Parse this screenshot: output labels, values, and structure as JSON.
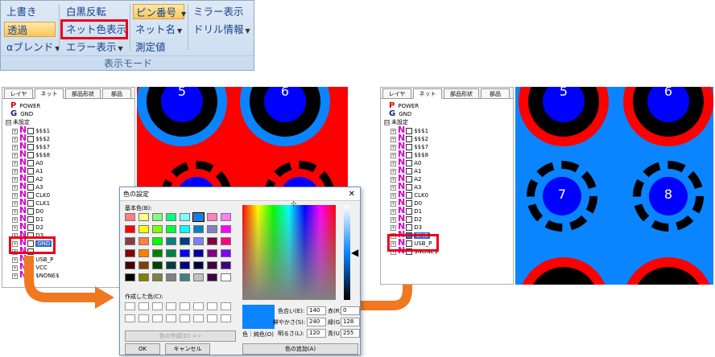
{
  "ribbon": {
    "overwrite": "上書き",
    "transparent": "透過",
    "alpha_blend": "αブレンド",
    "invert": "白黒反転",
    "net_color": "ネット色表示",
    "error_display": "エラー表示",
    "pin_number": "ピン番号",
    "net_name": "ネット名",
    "measured_value": "測定値",
    "mirror": "ミラー表示",
    "drill_info": "ドリル情報",
    "group_label": "表示モード"
  },
  "left_panel": {
    "tabs": [
      "レイヤ",
      "ネット",
      "部品形状",
      "部品"
    ],
    "top_rows": [
      {
        "icon": "P",
        "label": "POWER"
      },
      {
        "icon": "G",
        "label": "GND"
      },
      {
        "icon": "",
        "label": "未設定"
      }
    ],
    "nets": [
      "$$$1",
      "$$$2",
      "$$$7",
      "$$$8",
      "A0",
      "A1",
      "A2",
      "A3",
      "CLK0",
      "CLK1",
      "D0",
      "D1",
      "D2",
      "D3",
      "GND",
      "",
      "USB_P",
      "VCC",
      "$NONE$"
    ]
  },
  "right_panel": {
    "tabs": [
      "レイヤ",
      "ネット",
      "部品形状",
      "部品"
    ],
    "top_rows": [
      {
        "icon": "P",
        "label": "POWER"
      },
      {
        "icon": "G",
        "label": "GND"
      },
      {
        "icon": "",
        "label": "未設定"
      }
    ],
    "nets": [
      "$$$1",
      "$$$2",
      "$$$7",
      "$$$8",
      "A0",
      "A1",
      "A2",
      "A3",
      "CLK0",
      "D0",
      "D1",
      "D2",
      "D3",
      "GND",
      "USB_P",
      "$NONE$"
    ]
  },
  "board_left": {
    "pins": [
      "5",
      "6"
    ],
    "bg_color": "#ff0000"
  },
  "board_right": {
    "pins": [
      "5",
      "6",
      "7",
      "8"
    ],
    "bg_color": "#0a84ff"
  },
  "color_dialog": {
    "title": "色の設定",
    "basic_colors_label": "基本色(B):",
    "custom_colors_label": "作成した色(C):",
    "define_button": "色の作成(D) >>",
    "ok": "OK",
    "cancel": "キャンセル",
    "color_solid_label": "色｜純色(O)",
    "hue_label": "色合い(E):",
    "hue": "140",
    "sat_label": "鮮やかさ(S):",
    "sat": "240",
    "lum_label": "明るさ(L):",
    "lum": "120",
    "red_label": "赤(R):",
    "red": "0",
    "green_label": "緑(G):",
    "green": "128",
    "blue_label": "青(U):",
    "blue": "255",
    "add_button": "色の追加(A)",
    "selected_color": "#0a84ff"
  },
  "colors": {
    "highlight": "#e8001c",
    "arrow": "#f07820",
    "net_selected": "#0a84ff"
  }
}
